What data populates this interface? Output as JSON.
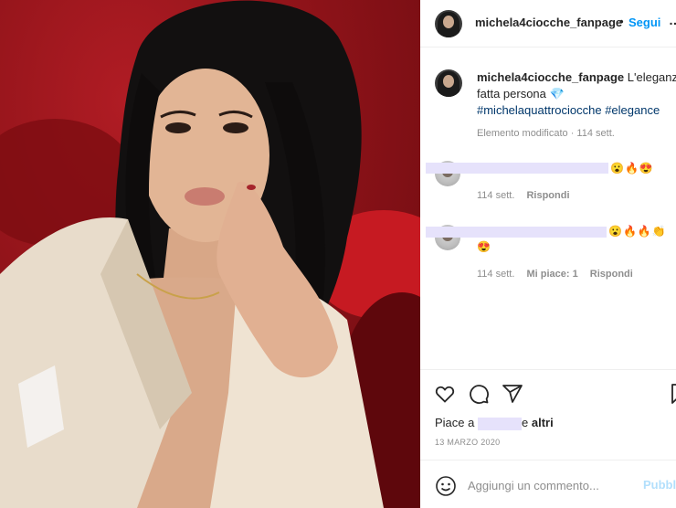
{
  "post": {
    "username": "michela4ciocche_fanpage",
    "follow_separator": "•",
    "follow_label": "Segui",
    "more_label": "…"
  },
  "caption": {
    "username": "michela4ciocche_fanpage",
    "text_line1": "L'eleganza",
    "text_line2": "fatta persona",
    "gem_emoji": "💎",
    "hashtag1": "#michelaquattrociocche",
    "hashtag2": "#elegance",
    "meta": "Elemento modificato · 114 sett."
  },
  "comments": [
    {
      "emojis": "😮🔥😍",
      "time": "114 sett.",
      "likes": "",
      "reply": "Rispondi"
    },
    {
      "emojis": "😮🔥🔥👏",
      "emojis_line2": "😍",
      "time": "114 sett.",
      "likes": "Mi piace: 1",
      "reply": "Rispondi"
    }
  ],
  "likes": {
    "prefix": "Piace a",
    "suffix_and": "e",
    "suffix_others": "altri"
  },
  "date": "13 MARZO 2020",
  "comment_box": {
    "placeholder": "Aggiungi un commento...",
    "publish_label": "Pubbl"
  }
}
